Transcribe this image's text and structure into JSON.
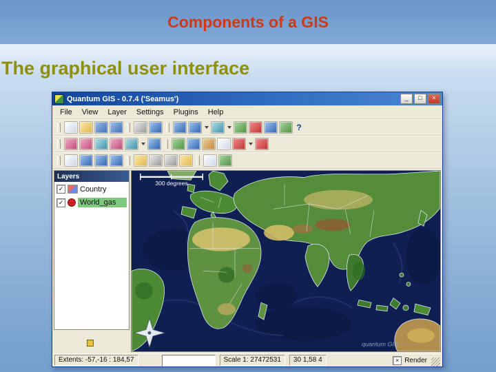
{
  "slide": {
    "title": "Components of a GIS",
    "subtitle": "The graphical user interface",
    "title_color": "#cc3a1a",
    "subtitle_color": "#8f8f0a"
  },
  "window": {
    "title": "Quantum GIS - 0.7.4 ('Seamus')",
    "controls": {
      "minimize": "_",
      "maximize": "□",
      "close": "×"
    },
    "menus": [
      "File",
      "View",
      "Layer",
      "Settings",
      "Plugins",
      "Help"
    ],
    "help_glyph": "?",
    "toolbar_row1": [
      "new-project-icon",
      "open-project-icon",
      "save-project-icon",
      "save-project-as-icon",
      "print-icon",
      "export-image-icon",
      "add-vector-layer-icon",
      "add-raster-layer-icon",
      "add-postgis-layer-icon",
      "new-vector-layer-icon",
      "remove-layer-icon",
      "add-to-overview-icon",
      "show-all-layers-icon",
      "help-icon"
    ],
    "toolbar_row2": [
      "zoom-in-icon",
      "zoom-out-icon",
      "zoom-full-icon",
      "zoom-selection-icon",
      "zoom-layer-icon",
      "zoom-last-icon",
      "refresh-icon",
      "identify-icon",
      "select-features-icon",
      "attribute-table-icon",
      "measure-line-icon",
      "measure-area-icon"
    ],
    "toolbar_row3": [
      "pan-icon",
      "capture-point-icon",
      "capture-line-icon",
      "capture-polygon-icon",
      "toggle-editing-icon",
      "cut-icon",
      "copy-icon",
      "paste-icon",
      "north-arrow-icon",
      "scalebar-icon"
    ]
  },
  "layers_panel": {
    "header": "Layers",
    "items": [
      {
        "label": "Country",
        "check": "✓",
        "selected": false
      },
      {
        "label": "World_gas",
        "check": "✓",
        "selected": true
      }
    ]
  },
  "map": {
    "scalebar_label": "300 degrees",
    "watermark": "quantum GIS",
    "ocean_color": "#101f52"
  },
  "statusbar": {
    "extents": "Extents: -57,-16 : 184,57",
    "coord_value": "",
    "scale": "Scale 1: 27472531",
    "coords": "30 1,58 4",
    "render_label": "Render",
    "render_check": "×"
  }
}
